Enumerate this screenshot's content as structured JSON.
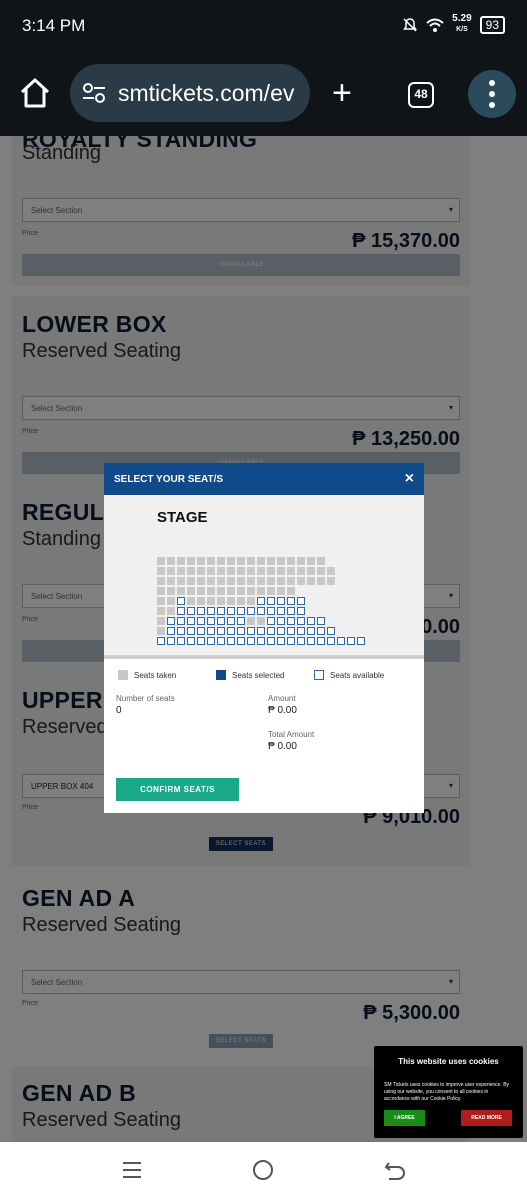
{
  "status": {
    "time": "3:14 PM",
    "speed_top": "5.29",
    "speed_unit": "K/S",
    "battery": "93"
  },
  "browser": {
    "url": "smtickets.com/ev",
    "tab_count": "48"
  },
  "tickets": [
    {
      "name": "ROYALTY STANDING",
      "type": "Standing",
      "select": "Select Section",
      "price_label": "Price",
      "price": "₱ 15,370.00",
      "button": "UNAVAILABLE"
    },
    {
      "name": "LOWER BOX",
      "type": "Reserved Seating",
      "select": "Select Section",
      "price_label": "Price",
      "price": "₱ 13,250.00",
      "button": "UNAVAILABLE"
    },
    {
      "name": "REGULAR",
      "type": "Standing",
      "select": "Select Section",
      "price_label": "Price",
      "price": "₱ 0.00",
      "button": "UNAVAILABLE"
    },
    {
      "name": "UPPER BOX",
      "type": "Reserved Seating",
      "select": "UPPER BOX 404",
      "price_label": "Price",
      "price": "₱ 9,010.00",
      "button": "SELECT SEATS"
    },
    {
      "name": "GEN AD A",
      "type": "Reserved Seating",
      "select": "Select Section",
      "price_label": "Price",
      "price": "₱ 5,300.00",
      "button": "SELECT SEATS"
    },
    {
      "name": "GEN AD B",
      "type": "Reserved Seating"
    }
  ],
  "modal": {
    "title": "SELECT YOUR SEAT/S",
    "close": "×",
    "stage": "STAGE",
    "legend": {
      "taken": "Seats taken",
      "selected": "Seats selected",
      "available": "Seats available"
    },
    "num_seats_label": "Number of seats",
    "num_seats_value": "0",
    "amount_label": "Amount",
    "amount_value": "₱ 0.00",
    "total_label": "Total Amount",
    "total_value": "₱ 0.00",
    "confirm": "CONFIRM SEAT/S",
    "colors": {
      "header": "#0f4a8a",
      "taken": "#c8c8c8",
      "selected": "#0f4a8a",
      "available": "#2f6aa8",
      "confirm": "#1aaa8a"
    }
  },
  "cookie": {
    "title": "This website uses cookies",
    "text": "SM Tickets uses cookies to improve user experience. By using our website, you consent to all cookies in accordance with our Cookie Policy.",
    "agree": "I AGREE",
    "more": "READ MORE"
  },
  "icons": [
    "home-icon",
    "tune-icon",
    "plus-icon",
    "tabs-icon",
    "more-vert-icon",
    "recents-icon",
    "home-circle-icon",
    "back-icon"
  ]
}
